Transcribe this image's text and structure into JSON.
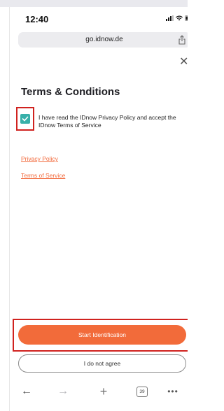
{
  "status_bar": {
    "time": "12:40"
  },
  "browser": {
    "url": "go.idnow.de",
    "tab_count": "39"
  },
  "page": {
    "title": "Terms & Conditions",
    "consent_text": "I have read the IDnow Privacy Policy and accept the IDnow Terms of Service",
    "checkbox_checked": true,
    "links": {
      "privacy_policy": "Privacy Policy",
      "terms_of_service": "Terms of Service"
    },
    "start_button_label": "Start Identification",
    "disagree_button_label": "I do not agree"
  },
  "icons": {
    "close": "close-icon",
    "share": "share-icon",
    "back": "back-arrow-icon",
    "forward": "forward-arrow-icon",
    "new_tab": "plus-icon",
    "tabs": "tabs-icon",
    "more": "more-icon"
  },
  "colors": {
    "accent": "#f26b3a",
    "checkbox": "#37b0a9",
    "highlight": "#d0221f"
  }
}
